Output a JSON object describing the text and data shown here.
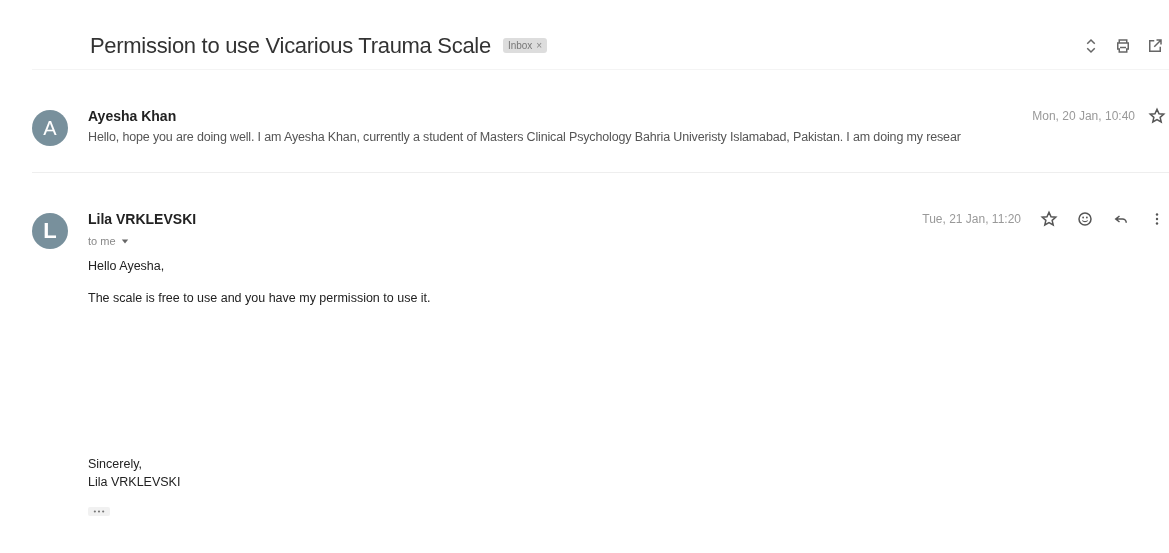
{
  "thread": {
    "subject": "Permission to use Vicarious Trauma Scale",
    "label": {
      "text": "Inbox",
      "close": "×"
    }
  },
  "messages": [
    {
      "kind": "collapsed",
      "initial": "A",
      "sender": "Ayesha Khan",
      "date": "Mon, 20 Jan, 10:40",
      "starred": false,
      "snippet": "Hello, hope you are doing well. I am Ayesha Khan, currently a student of Masters Clinical Psychology Bahria Univeristy Islamabad, Pakistan. I am doing my resear"
    },
    {
      "kind": "expanded",
      "initial": "L",
      "sender": "Lila VRKLEVSKI",
      "date": "Tue, 21 Jan, 11:20",
      "starred": false,
      "recipient": "to me",
      "paragraphs": [
        [
          "Hello Ayesha,"
        ],
        [
          "The scale is free to use and you have my permission to use it."
        ]
      ],
      "signature": [
        "Sincerely,",
        "Lila VRKLEVSKI"
      ]
    }
  ]
}
